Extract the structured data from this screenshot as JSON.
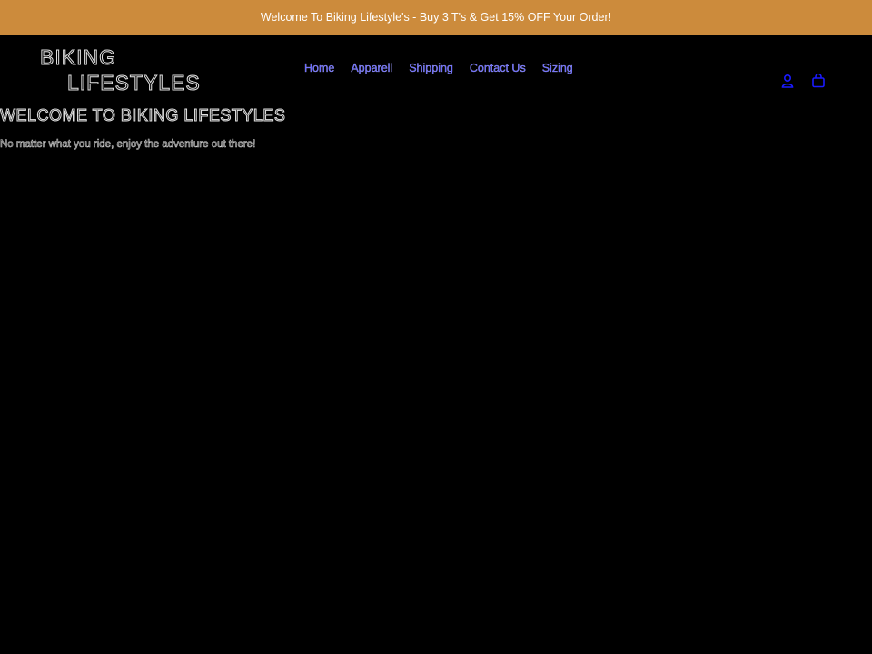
{
  "announcement": {
    "text": "Welcome To Biking Lifestyle's - Buy 3 T's & Get 15% OFF Your Order!"
  },
  "logo": {
    "line1": "BIKING",
    "line2": "LIFESTYLES"
  },
  "nav": {
    "items": [
      {
        "label": "Home"
      },
      {
        "label": "Apparell"
      },
      {
        "label": "Shipping"
      },
      {
        "label": "Contact Us"
      },
      {
        "label": "Sizing"
      }
    ]
  },
  "header_icons": {
    "account": "account-icon",
    "cart": "cart-icon"
  },
  "hero": {
    "title": "WELCOME TO BIKING LIFESTYLES",
    "subtitle": "No matter what you ride, enjoy the adventure out there!"
  },
  "colors": {
    "announcement_bg": "#cc8b3c",
    "page_bg": "#000000",
    "nav_link": "#5d5dff",
    "icon": "#1a1aff"
  }
}
